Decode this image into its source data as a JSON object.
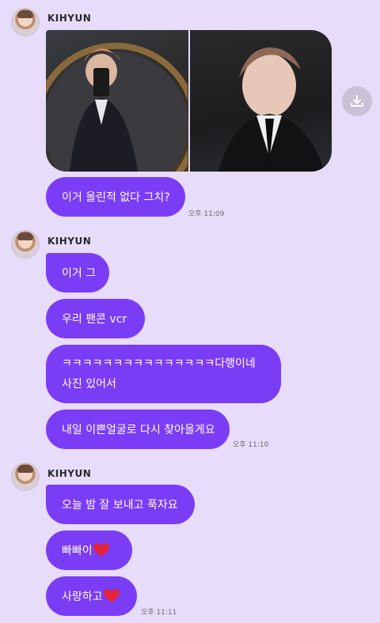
{
  "groups": [
    {
      "sender": "KIHYUN",
      "messages": [
        {
          "type": "image",
          "count": 2
        },
        {
          "type": "text",
          "text": "이거 올린적 없다 그치?",
          "time": "오후 11:09"
        }
      ]
    },
    {
      "sender": "KIHYUN",
      "messages": [
        {
          "type": "text",
          "text": "이거 그"
        },
        {
          "type": "text",
          "text": "우리 팬콘 vcr"
        },
        {
          "type": "text",
          "lines": [
            "ㅋㅋㅋㅋㅋㅋㅋㅋㅋㅋㅋㅋㅋㅋㅋ다행이네",
            "사진 있어서"
          ]
        },
        {
          "type": "text",
          "text": "내일 이쁜얼굴로 다시 찾아올게요",
          "time": "오후 11:10"
        }
      ]
    },
    {
      "sender": "KIHYUN",
      "messages": [
        {
          "type": "text",
          "text": "오늘 밤 잘 보내고 푹자요"
        },
        {
          "type": "text",
          "text": "빠빠이",
          "emoji": "red-heart"
        },
        {
          "type": "text",
          "text": "사랑하고",
          "emoji": "red-heart",
          "time": "오후 11:11"
        }
      ]
    }
  ],
  "icons": {
    "download": "download-icon",
    "heart": "red-heart-emoji"
  },
  "colors": {
    "background": "#e7dcf9",
    "bubble": "#7b3cf5",
    "bubble_text": "#ffffff"
  }
}
